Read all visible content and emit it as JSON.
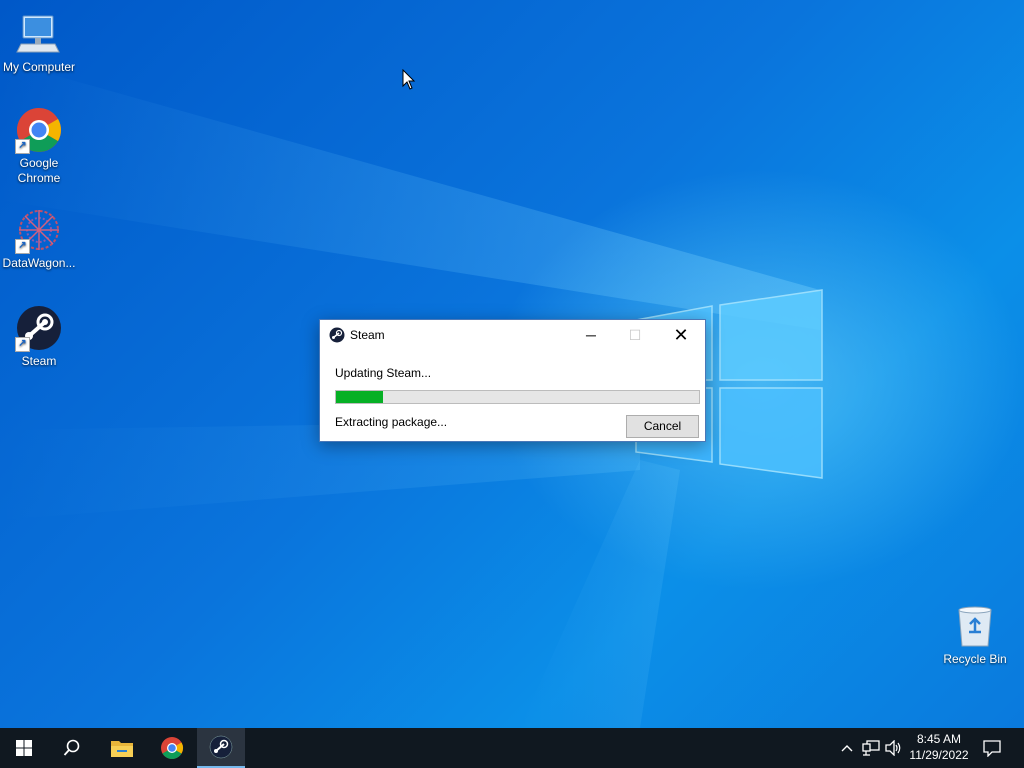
{
  "desktop": {
    "icons": [
      {
        "label": "My Computer",
        "icon": "computer-icon"
      },
      {
        "label": "Google Chrome",
        "icon": "chrome-icon"
      },
      {
        "label": "DataWagon...",
        "icon": "datawagon-icon"
      },
      {
        "label": "Steam",
        "icon": "steam-icon"
      },
      {
        "label": "Recycle Bin",
        "icon": "recycle-bin-icon"
      }
    ]
  },
  "dialog": {
    "title": "Steam",
    "status_line1": "Updating Steam...",
    "status_line2": "Extracting package...",
    "progress": 0.13,
    "cancel_label": "Cancel",
    "minimize_glyph": "─",
    "maximize_glyph": "☐",
    "close_glyph": "✕"
  },
  "taskbar": {
    "items": [
      "start-icon",
      "search-icon",
      "file-explorer-icon",
      "chrome-icon",
      "steam-icon"
    ],
    "active_item": "steam-icon",
    "time": "8:45 AM",
    "date": "11/29/2022"
  },
  "colors": {
    "accent": "#0078d7",
    "progress_fill": "#06b025",
    "taskbar": "#101820"
  }
}
